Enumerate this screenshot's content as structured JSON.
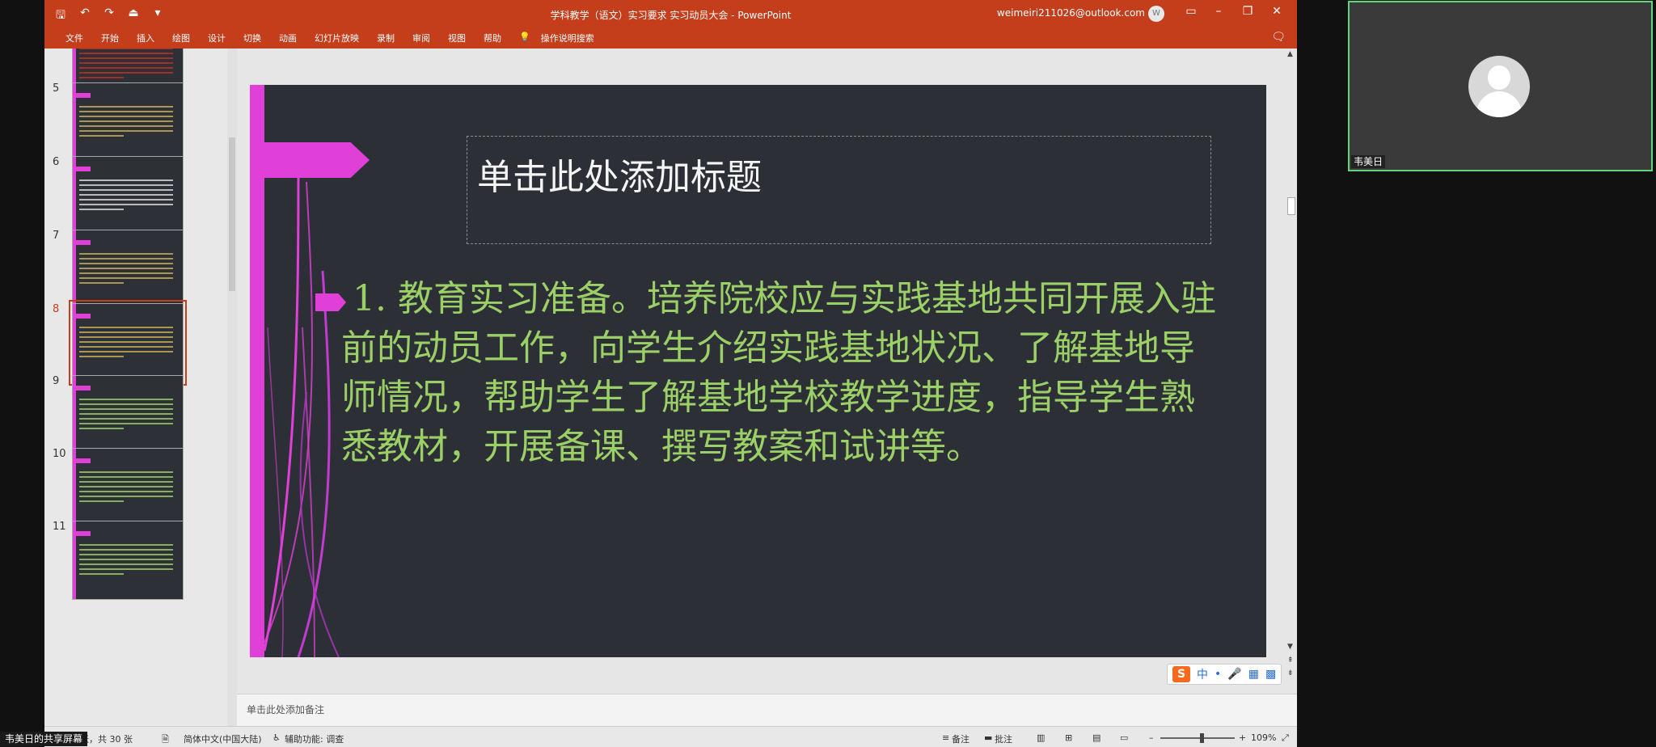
{
  "window": {
    "title": "学科教学（语文）实习要求 实习动员大会 - PowerPoint",
    "account": "weimeiri211026@outlook.com",
    "account_initial": "W"
  },
  "qat": {
    "save": "🖫",
    "undo": "↶",
    "redo": "↷",
    "present": "⏏",
    "more": "▾"
  },
  "ribbon": {
    "tabs": [
      "文件",
      "开始",
      "插入",
      "绘图",
      "设计",
      "切换",
      "动画",
      "幻灯片放映",
      "录制",
      "审阅",
      "视图",
      "帮助"
    ],
    "search": "操作说明搜索"
  },
  "thumbnails": [
    {
      "num": "",
      "style": "red"
    },
    {
      "num": "5",
      "style": "normal"
    },
    {
      "num": "6",
      "style": "white"
    },
    {
      "num": "7",
      "style": "normal"
    },
    {
      "num": "8",
      "style": "normal",
      "selected": true
    },
    {
      "num": "9",
      "style": "green"
    },
    {
      "num": "10",
      "style": "green"
    },
    {
      "num": "11",
      "style": "green"
    }
  ],
  "slide": {
    "title_placeholder": "单击此处添加标题",
    "body": "1. 教育实习准备。培养院校应与实践基地共同开展入驻前的动员工作，向学生介绍实践基地状况、了解基地导师情况，帮助学生了解基地学校教学进度，指导学生熟悉教材，开展备课、撰写教案和试讲等。",
    "accent_color": "#e040d8",
    "text_color": "#9bd067",
    "background": "#2d2f37"
  },
  "ime": {
    "logo": "S",
    "lang": "中",
    "punct": "•",
    "voice": "🎤",
    "keyboard": "▦",
    "tools": "▩"
  },
  "notes": {
    "placeholder": "单击此处添加备注"
  },
  "status": {
    "slide_info": "张，共 30 张",
    "language": "简体中文(中国大陆)",
    "accessibility": "辅助功能: 调查",
    "notes_btn": "备注",
    "comments_btn": "批注",
    "zoom": "109%",
    "zoom_level": 0.55
  },
  "share_label": "韦美日的共享屏幕",
  "participant": {
    "name": "韦美日"
  }
}
